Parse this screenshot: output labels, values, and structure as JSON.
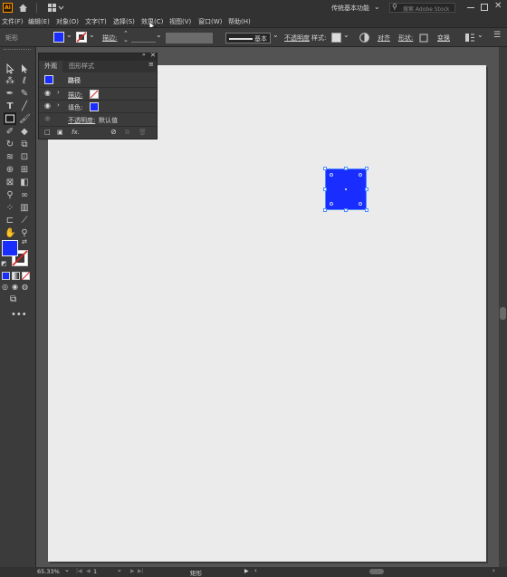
{
  "app": {
    "logo": "Ai",
    "workspace": "传统基本功能",
    "search_placeholder": "搜索 Adobe Stock"
  },
  "menu": [
    {
      "label": "文件(F)"
    },
    {
      "label": "编辑(E)"
    },
    {
      "label": "对象(O)"
    },
    {
      "label": "文字(T)"
    },
    {
      "label": "选择(S)"
    },
    {
      "label": "效果(C)"
    },
    {
      "label": "视图(V)"
    },
    {
      "label": "窗口(W)"
    },
    {
      "label": "帮助(H)"
    }
  ],
  "control": {
    "object_type": "矩形",
    "fill_color": "#1a2dff",
    "stroke_label": "描边:",
    "stroke_style": "基本",
    "opacity_label": "不透明度",
    "style_label": "样式:",
    "align_label": "对齐",
    "shape_label": "形状:",
    "transform_label": "变换"
  },
  "panel": {
    "tabs": [
      {
        "label": "外观"
      },
      {
        "label": "图形样式"
      }
    ],
    "object_label": "路径",
    "stroke_label": "描边:",
    "fill_label": "填色:",
    "opacity_label": "不透明度:",
    "opacity_value": "默认值",
    "fx_label": "fx."
  },
  "status": {
    "zoom": "65.33%",
    "artboard": "1",
    "tool_name": "矩形"
  },
  "colors": {
    "fill": "#1a2dff",
    "ui_dark": "#323232",
    "ui_mid": "#3b3b3b"
  }
}
